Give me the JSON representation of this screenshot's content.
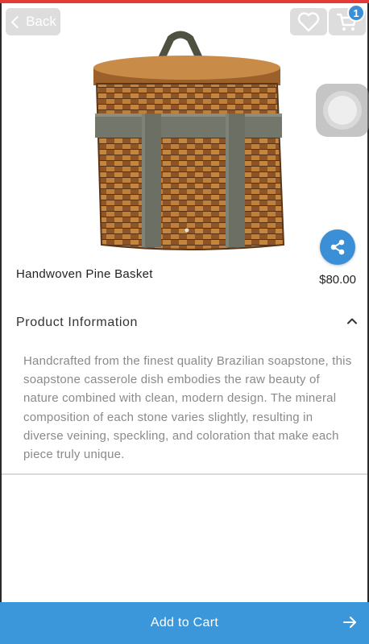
{
  "header": {
    "back_label": "Back",
    "back_icon": "chevron-left-icon",
    "favorite_icon": "heart-icon",
    "cart_icon": "cart-icon",
    "cart_count": "1"
  },
  "product": {
    "name": "Handwoven Pine Basket",
    "price": "$80.00"
  },
  "info": {
    "title": "Product Information",
    "expanded": true,
    "description": "Handcrafted from the finest quality Brazilian soapstone, this soapstone casserole dish embodies the raw beauty of nature combined with clean, modern design. The mineral composition of each stone varies slightly, resulting in diverse veining, speckling, and coloration that make each piece truly unique."
  },
  "footer": {
    "add_to_cart_label": "Add to Cart"
  },
  "colors": {
    "accent_blue": "#3b97d9",
    "top_accent_red": "#e53935"
  }
}
